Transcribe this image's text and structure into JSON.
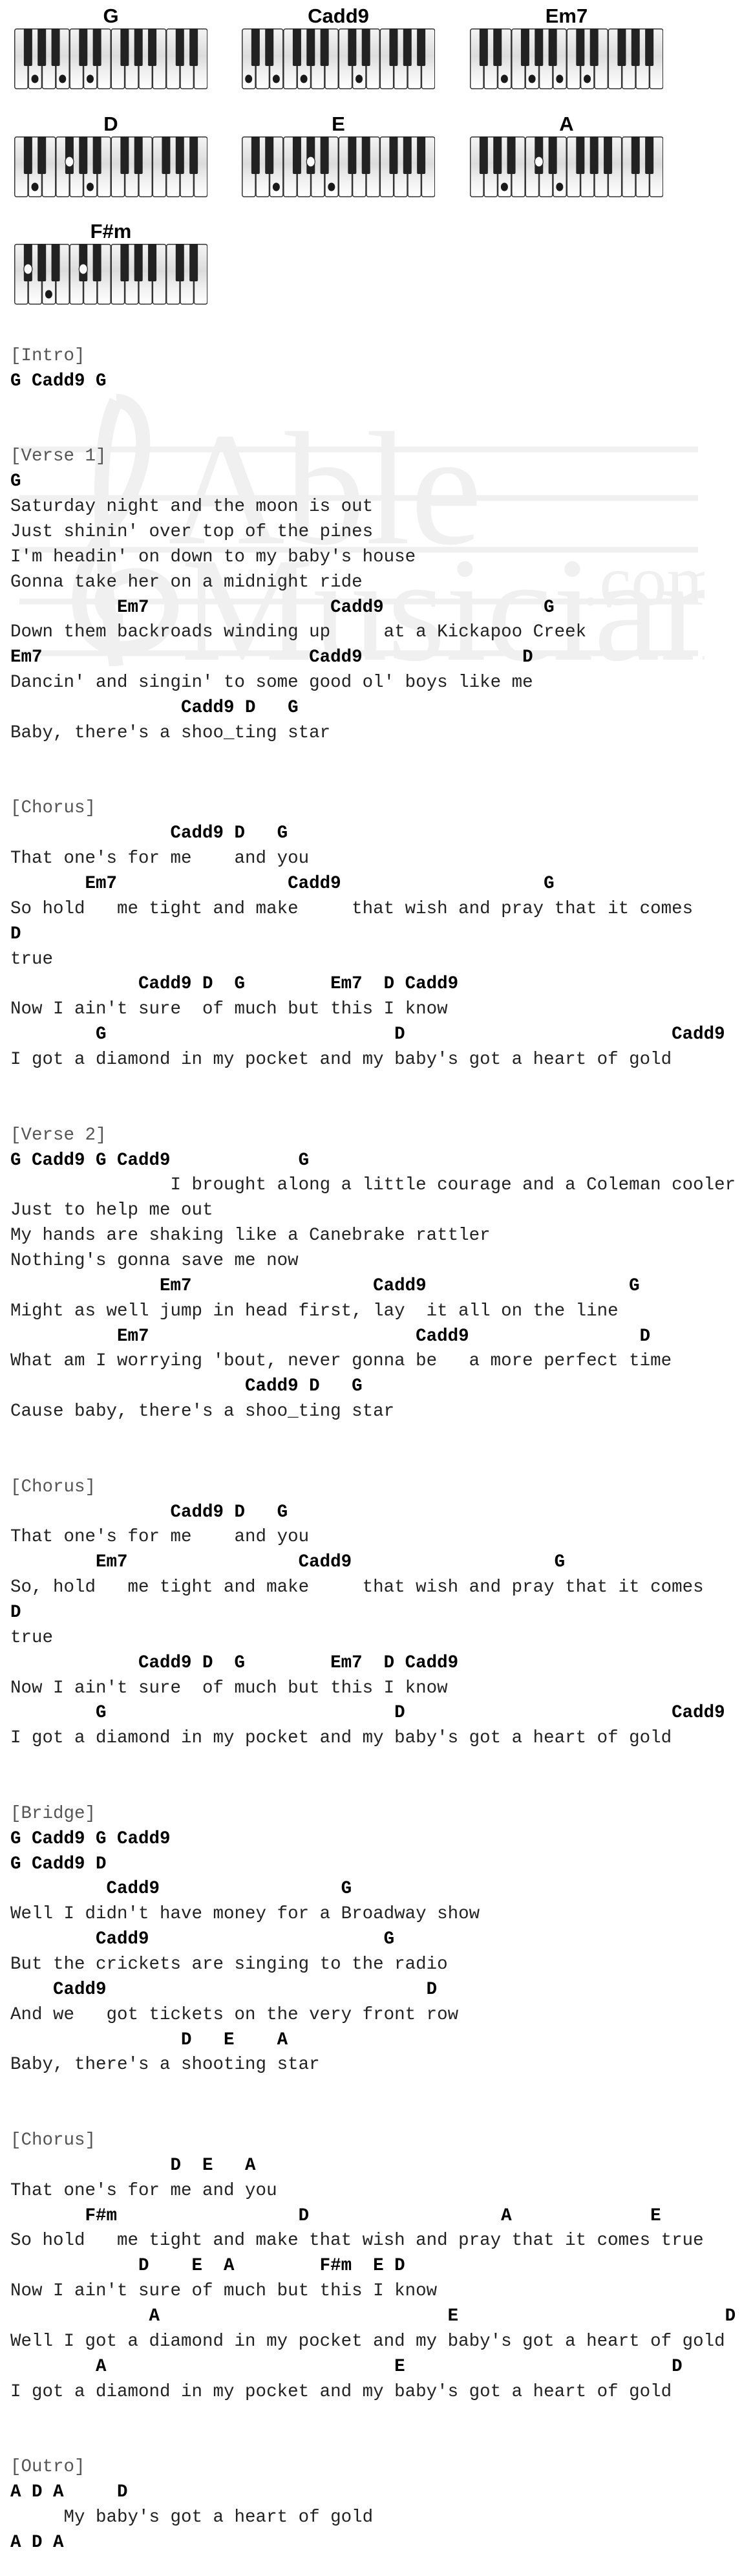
{
  "diagrams": [
    {
      "name": "G",
      "start": "F",
      "pressed_white": [
        1,
        3,
        5
      ],
      "pressed_black": []
    },
    {
      "name": "Cadd9",
      "start": "C",
      "pressed_white": [
        0,
        2,
        4,
        8
      ],
      "pressed_black": []
    },
    {
      "name": "Em7",
      "start": "C",
      "pressed_white": [
        2,
        4,
        6,
        8
      ],
      "pressed_black": []
    },
    {
      "name": "D",
      "start": "C",
      "pressed_white": [
        1,
        5
      ],
      "pressed_black": [
        3
      ]
    },
    {
      "name": "E",
      "start": "C",
      "pressed_white": [
        2,
        6
      ],
      "pressed_black": [
        4
      ]
    },
    {
      "name": "A",
      "start": "F",
      "pressed_white": [
        2,
        6
      ],
      "pressed_black": [
        4
      ]
    },
    {
      "name": "F#m",
      "start": "F",
      "pressed_white": [
        2
      ],
      "pressed_black": [
        0,
        4
      ]
    }
  ],
  "watermark": {
    "line1": "Able",
    "line2": "Musician",
    "suffix": ".com"
  },
  "lines": [
    {
      "type": "section",
      "text": "[Intro]"
    },
    {
      "type": "chord",
      "text": "G Cadd9 G"
    },
    {
      "type": "blank",
      "text": ""
    },
    {
      "type": "blank",
      "text": ""
    },
    {
      "type": "section",
      "text": "[Verse 1]"
    },
    {
      "type": "chord",
      "text": "G"
    },
    {
      "type": "lyric",
      "text": "Saturday night and the moon is out"
    },
    {
      "type": "lyric",
      "text": "Just shinin' over top of the pines"
    },
    {
      "type": "lyric",
      "text": "I'm headin' on down to my baby's house"
    },
    {
      "type": "lyric",
      "text": "Gonna take her on a midnight ride"
    },
    {
      "type": "chord",
      "text": "          Em7                 Cadd9               G"
    },
    {
      "type": "lyric",
      "text": "Down them backroads winding up     at a Kickapoo Creek"
    },
    {
      "type": "chord",
      "text": "Em7                         Cadd9               D"
    },
    {
      "type": "lyric",
      "text": "Dancin' and singin' to some good ol' boys like me"
    },
    {
      "type": "chord",
      "text": "                Cadd9 D   G"
    },
    {
      "type": "lyric",
      "text": "Baby, there's a shoo_ting star"
    },
    {
      "type": "blank",
      "text": ""
    },
    {
      "type": "blank",
      "text": ""
    },
    {
      "type": "section",
      "text": "[Chorus]"
    },
    {
      "type": "chord",
      "text": "               Cadd9 D   G"
    },
    {
      "type": "lyric",
      "text": "That one's for me    and you"
    },
    {
      "type": "chord",
      "text": "       Em7                Cadd9                   G"
    },
    {
      "type": "lyric",
      "text": "So hold   me tight and make     that wish and pray that it comes"
    },
    {
      "type": "chord",
      "text": "D"
    },
    {
      "type": "lyric",
      "text": "true"
    },
    {
      "type": "chord",
      "text": "            Cadd9 D  G        Em7  D Cadd9"
    },
    {
      "type": "lyric",
      "text": "Now I ain't sure  of much but this I know"
    },
    {
      "type": "chord",
      "text": "        G                           D                         Cadd9"
    },
    {
      "type": "lyric",
      "text": "I got a diamond in my pocket and my baby's got a heart of gold"
    },
    {
      "type": "blank",
      "text": ""
    },
    {
      "type": "blank",
      "text": ""
    },
    {
      "type": "section",
      "text": "[Verse 2]"
    },
    {
      "type": "chord",
      "text": "G Cadd9 G Cadd9            G"
    },
    {
      "type": "lyric",
      "text": "               I brought along a little courage and a Coleman cooler"
    },
    {
      "type": "lyric",
      "text": "Just to help me out"
    },
    {
      "type": "lyric",
      "text": "My hands are shaking like a Canebrake rattler"
    },
    {
      "type": "lyric",
      "text": "Nothing's gonna save me now"
    },
    {
      "type": "chord",
      "text": "              Em7                 Cadd9                   G"
    },
    {
      "type": "lyric",
      "text": "Might as well jump in head first, lay  it all on the line"
    },
    {
      "type": "chord",
      "text": "          Em7                         Cadd9                D"
    },
    {
      "type": "lyric",
      "text": "What am I worrying 'bout, never gonna be   a more perfect time"
    },
    {
      "type": "chord",
      "text": "                      Cadd9 D   G"
    },
    {
      "type": "lyric",
      "text": "Cause baby, there's a shoo_ting star"
    },
    {
      "type": "blank",
      "text": ""
    },
    {
      "type": "blank",
      "text": ""
    },
    {
      "type": "section",
      "text": "[Chorus]"
    },
    {
      "type": "chord",
      "text": "               Cadd9 D   G"
    },
    {
      "type": "lyric",
      "text": "That one's for me    and you"
    },
    {
      "type": "chord",
      "text": "        Em7                Cadd9                   G"
    },
    {
      "type": "lyric",
      "text": "So, hold   me tight and make     that wish and pray that it comes"
    },
    {
      "type": "chord",
      "text": "D"
    },
    {
      "type": "lyric",
      "text": "true"
    },
    {
      "type": "chord",
      "text": "            Cadd9 D  G        Em7  D Cadd9"
    },
    {
      "type": "lyric",
      "text": "Now I ain't sure  of much but this I know"
    },
    {
      "type": "chord",
      "text": "        G                           D                         Cadd9"
    },
    {
      "type": "lyric",
      "text": "I got a diamond in my pocket and my baby's got a heart of gold"
    },
    {
      "type": "blank",
      "text": ""
    },
    {
      "type": "blank",
      "text": ""
    },
    {
      "type": "section",
      "text": "[Bridge]"
    },
    {
      "type": "chord",
      "text": "G Cadd9 G Cadd9"
    },
    {
      "type": "chord",
      "text": "G Cadd9 D"
    },
    {
      "type": "chord",
      "text": "         Cadd9                 G"
    },
    {
      "type": "lyric",
      "text": "Well I didn't have money for a Broadway show"
    },
    {
      "type": "chord",
      "text": "        Cadd9                      G"
    },
    {
      "type": "lyric",
      "text": "But the crickets are singing to the radio"
    },
    {
      "type": "chord",
      "text": "    Cadd9                              D"
    },
    {
      "type": "lyric",
      "text": "And we   got tickets on the very front row"
    },
    {
      "type": "chord",
      "text": "                D   E    A"
    },
    {
      "type": "lyric",
      "text": "Baby, there's a shooting star"
    },
    {
      "type": "blank",
      "text": ""
    },
    {
      "type": "blank",
      "text": ""
    },
    {
      "type": "section",
      "text": "[Chorus]"
    },
    {
      "type": "chord",
      "text": "               D  E   A"
    },
    {
      "type": "lyric",
      "text": "That one's for me and you"
    },
    {
      "type": "chord",
      "text": "       F#m                 D                  A             E"
    },
    {
      "type": "lyric",
      "text": "So hold   me tight and make that wish and pray that it comes true"
    },
    {
      "type": "chord",
      "text": "            D    E  A        F#m  E D"
    },
    {
      "type": "lyric",
      "text": "Now I ain't sure of much but this I know"
    },
    {
      "type": "chord",
      "text": "             A                           E                         D"
    },
    {
      "type": "lyric",
      "text": "Well I got a diamond in my pocket and my baby's got a heart of gold"
    },
    {
      "type": "chord",
      "text": "        A                           E                         D"
    },
    {
      "type": "lyric",
      "text": "I got a diamond in my pocket and my baby's got a heart of gold"
    },
    {
      "type": "blank",
      "text": ""
    },
    {
      "type": "blank",
      "text": ""
    },
    {
      "type": "section",
      "text": "[Outro]"
    },
    {
      "type": "chord",
      "text": "A D A     D"
    },
    {
      "type": "lyric",
      "text": "     My baby's got a heart of gold"
    },
    {
      "type": "chord",
      "text": "A D A"
    }
  ]
}
